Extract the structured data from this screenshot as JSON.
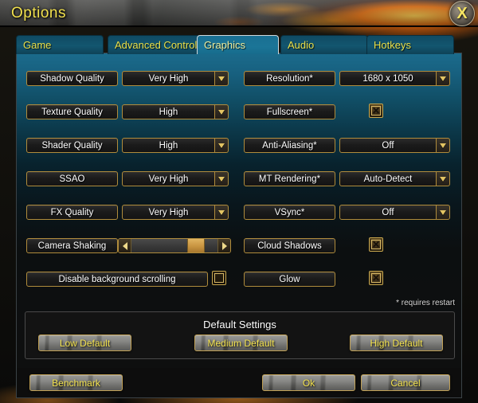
{
  "window": {
    "title": "Options",
    "close_icon": "close-x-icon"
  },
  "tabs": [
    {
      "label": "Game",
      "active": false
    },
    {
      "label": "Advanced Controls",
      "active": false
    },
    {
      "label": "Graphics",
      "active": true
    },
    {
      "label": "Audio",
      "active": false
    },
    {
      "label": "Hotkeys",
      "active": false
    }
  ],
  "settings_left": [
    {
      "label": "Shadow Quality",
      "type": "combo",
      "value": "Very High"
    },
    {
      "label": "Texture Quality",
      "type": "combo",
      "value": "High"
    },
    {
      "label": "Shader Quality",
      "type": "combo",
      "value": "High"
    },
    {
      "label": "SSAO",
      "type": "combo",
      "value": "Very High"
    },
    {
      "label": "FX Quality",
      "type": "combo",
      "value": "Very High"
    },
    {
      "label": "Camera Shaking",
      "type": "slider",
      "value": "85"
    },
    {
      "label": "Disable background scrolling",
      "type": "checkbox",
      "value": "off"
    }
  ],
  "settings_right": [
    {
      "label": "Resolution*",
      "type": "combo",
      "value": "1680 x 1050"
    },
    {
      "label": "Fullscreen*",
      "type": "checkbox",
      "value": "on"
    },
    {
      "label": "Anti-Aliasing*",
      "type": "combo",
      "value": "Off"
    },
    {
      "label": "MT Rendering*",
      "type": "combo",
      "value": "Auto-Detect"
    },
    {
      "label": "VSync*",
      "type": "combo",
      "value": "Off"
    },
    {
      "label": "Cloud Shadows",
      "type": "checkbox",
      "value": "on"
    },
    {
      "label": "Glow",
      "type": "checkbox",
      "value": "on"
    }
  ],
  "restart_note": "* requires restart",
  "default_settings": {
    "title": "Default Settings",
    "buttons": [
      {
        "label": "Low Default"
      },
      {
        "label": "Medium Default"
      },
      {
        "label": "High Default"
      }
    ]
  },
  "footer": {
    "benchmark": "Benchmark",
    "ok": "Ok",
    "cancel": "Cancel"
  },
  "checkbox_glyph": "✕"
}
